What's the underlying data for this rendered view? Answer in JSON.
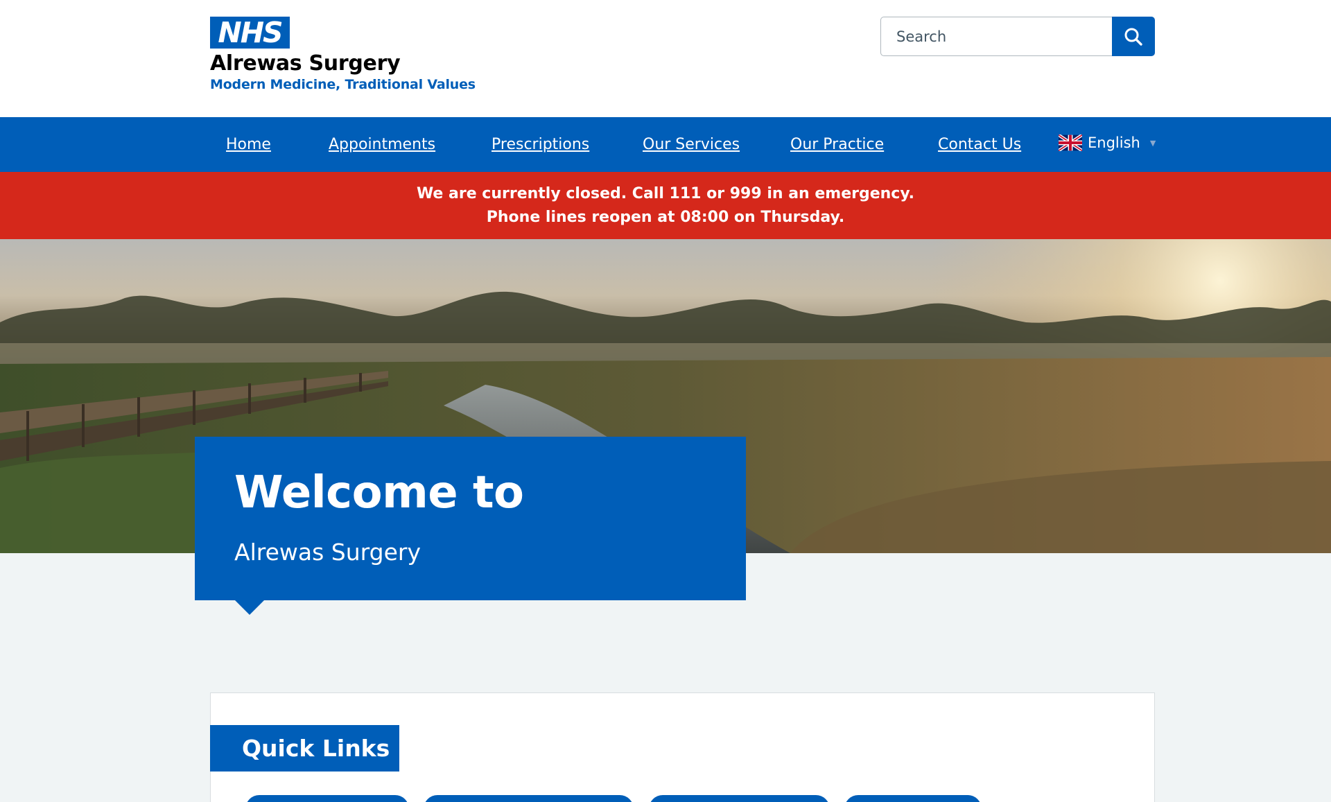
{
  "header": {
    "logo_text": "NHS",
    "practice_name": "Alrewas Surgery",
    "tagline": "Modern Medicine, Traditional Values",
    "search_placeholder": "Search"
  },
  "nav": {
    "items": [
      "Home",
      "Appointments",
      "Prescriptions",
      "Our Services",
      "Our Practice",
      "Contact Us"
    ],
    "language": "English"
  },
  "alert": {
    "line1": "We are currently closed. Call 111 or 999 in an emergency.",
    "line2": "Phone lines reopen at 08:00 on Thursday."
  },
  "hero": {
    "title": "Welcome to",
    "subtitle": "Alrewas Surgery"
  },
  "quick_links": {
    "title": "Quick Links"
  },
  "colors": {
    "nhs_blue": "#005eb8",
    "alert_red": "#d5281b",
    "page_bg": "#f0f4f5"
  }
}
